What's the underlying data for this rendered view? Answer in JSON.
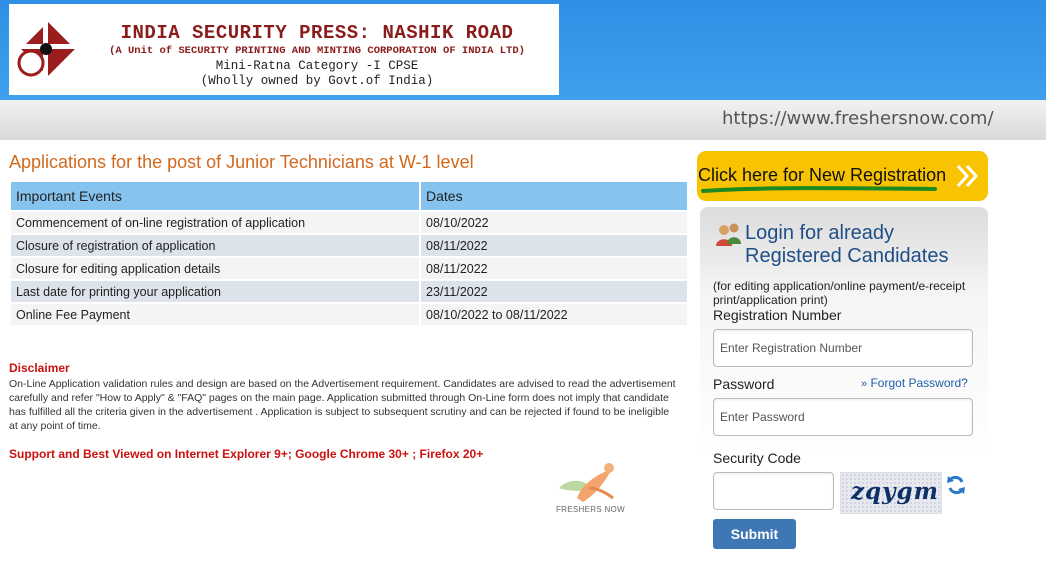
{
  "header": {
    "org_title": "INDIA SECURITY PRESS: NASHIK ROAD",
    "org_subtitle": "(A Unit of SECURITY PRINTING AND MINTING CORPORATION OF INDIA LTD)",
    "org_category": "Mini-Ratna Category -I CPSE",
    "org_ownership": "(Wholly owned by Govt.of India)",
    "logo_icon": "spmcil-logo-icon",
    "watermark_url": "https://www.freshersnow.com/"
  },
  "main": {
    "heading": "Applications for the post of Junior Technicians at W-1 level",
    "table": {
      "headers": [
        "Important Events",
        "Dates"
      ],
      "rows": [
        [
          "Commencement of on-line registration of application",
          "08/10/2022"
        ],
        [
          "Closure of registration of application",
          "08/11/2022"
        ],
        [
          "Closure for editing application details",
          "08/11/2022"
        ],
        [
          "Last date for printing your application",
          "23/11/2022"
        ],
        [
          "Online Fee Payment",
          "08/10/2022 to 08/11/2022"
        ]
      ]
    },
    "disclaimer_title": "Disclaimer",
    "disclaimer_text": "On-Line Application validation rules and design are based on the Advertisement requirement. Candidates are advised to read the advertisement carefully and refer \"How to Apply\" & \"FAQ\" pages on the main page. Application submitted through On-Line form does not imply that candidate has fulfilled all the criteria given in the advertisement . Application is subject to subsequent scrutiny and can be rejected if found to be ineligible at any point of time.",
    "support_note": "Support and Best Viewed on Internet Explorer 9+; Google Chrome 30+ ; Firefox 20+",
    "watermark_brand": "FRESHERS NOW"
  },
  "sidebar": {
    "register_label": "Click here for New Registration",
    "register_icon": "double-chevron-right-icon",
    "login_title": "Login for already Registered Candidates",
    "login_note": "(for editing application/online payment/e-receipt print/application print)",
    "registration_label": "Registration Number",
    "registration_placeholder": "Enter Registration Number",
    "registration_value": "",
    "password_label": "Password",
    "password_placeholder": "Enter Password",
    "password_value": "",
    "forgot_label": "Forgot Password?",
    "security_label": "Security Code",
    "security_value": "",
    "captcha_text": "zqygm",
    "submit_label": "Submit"
  },
  "colors": {
    "header_blue": "#3ea0ee",
    "heading_orange": "#d2691e",
    "table_header": "#86c4ef",
    "register_yellow": "#f8c301",
    "submit_blue": "#3e77b4",
    "disclaimer_red": "#cc1111",
    "underline_green": "#1e8a1e"
  }
}
